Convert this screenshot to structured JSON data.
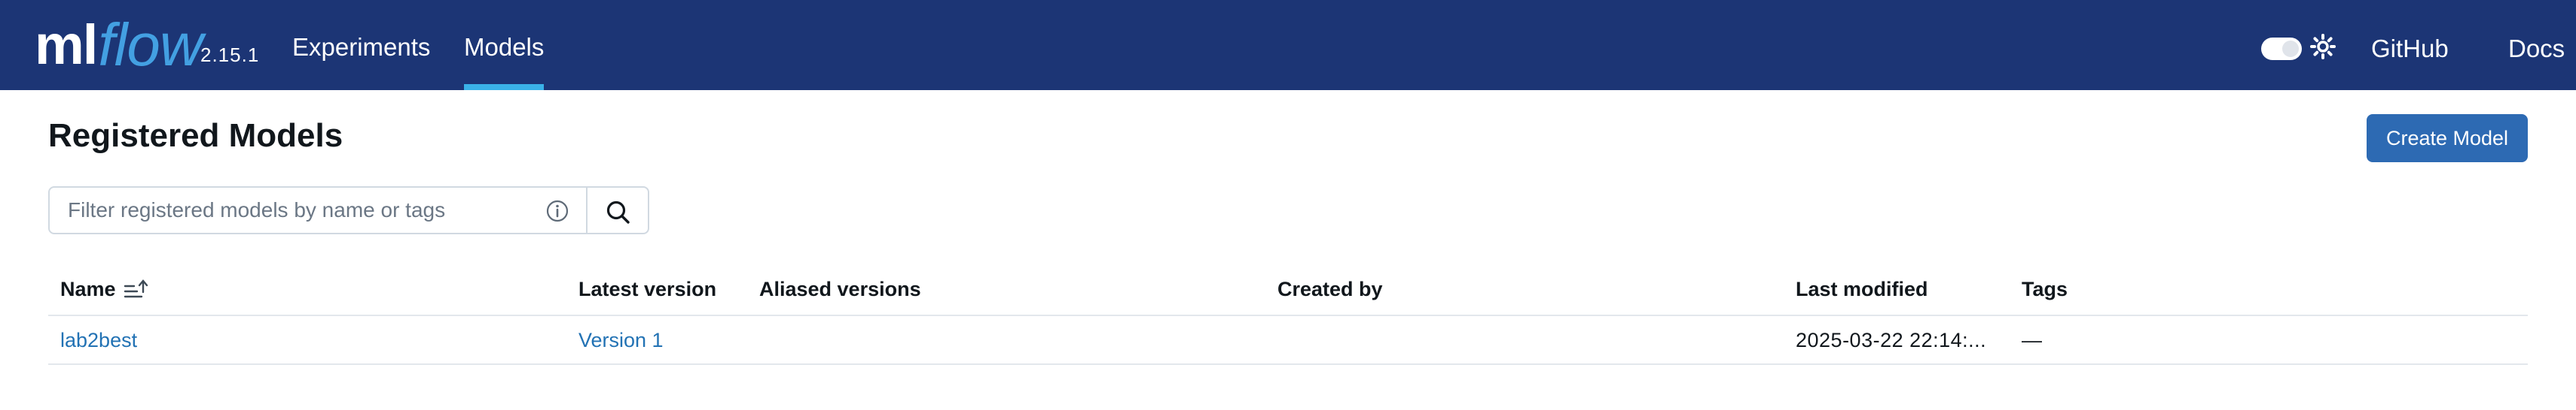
{
  "header": {
    "logo_ml": "ml",
    "logo_flow": "flow",
    "version": "2.15.1",
    "nav": [
      {
        "label": "Experiments",
        "active": false
      },
      {
        "label": "Models",
        "active": true
      }
    ],
    "links": {
      "github": "GitHub",
      "docs": "Docs"
    },
    "theme_toggle_icon": "toggle-switch",
    "theme_icon": "sun-icon",
    "colors": {
      "bar": "#1c3575",
      "accent": "#3ab2e8",
      "logo_flow": "#43a0e2"
    }
  },
  "page": {
    "title": "Registered Models",
    "create_button": "Create Model",
    "search": {
      "placeholder": "Filter registered models by name or tags",
      "value": ""
    }
  },
  "table": {
    "columns": [
      "Name",
      "Latest version",
      "Aliased versions",
      "Created by",
      "Last modified",
      "Tags"
    ],
    "sort_icon": "sort-ascending-icon",
    "rows": [
      {
        "name": "lab2best",
        "latest_version": "Version 1",
        "aliased_versions": "",
        "created_by": "",
        "last_modified": "2025-03-22 22:14:...",
        "tags": "—"
      }
    ]
  }
}
